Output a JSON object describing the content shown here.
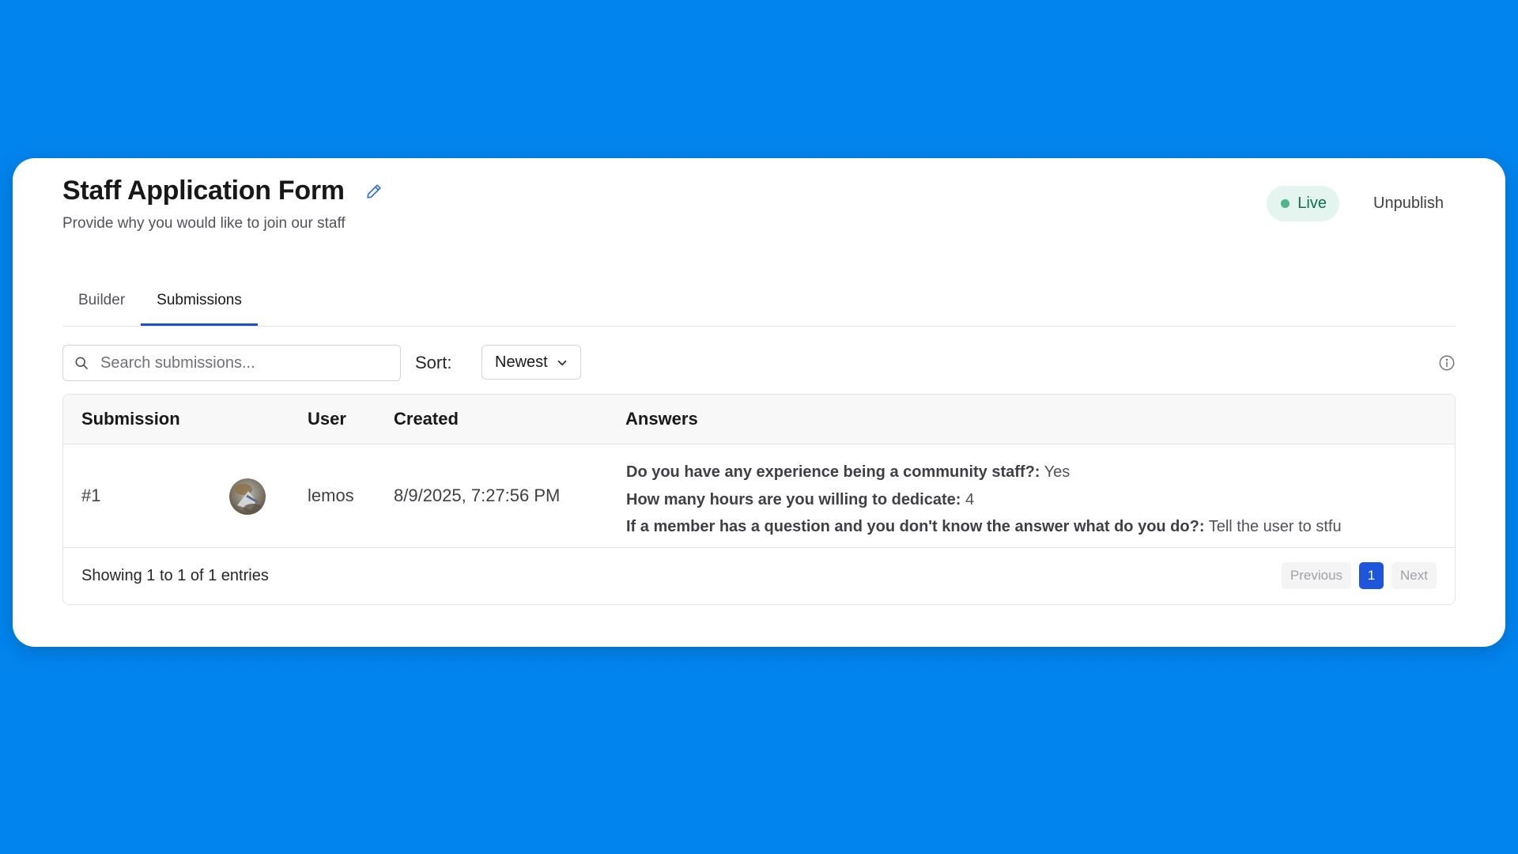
{
  "form": {
    "title": "Staff Application Form",
    "description": "Provide why you would like to join our staff"
  },
  "status": {
    "label": "Live",
    "color": "#4FB58A"
  },
  "actions": {
    "unpublish": "Unpublish"
  },
  "tabs": [
    {
      "label": "Builder",
      "active": false
    },
    {
      "label": "Submissions",
      "active": true
    }
  ],
  "toolbar": {
    "search_placeholder": "Search submissions...",
    "search_value": "",
    "sort_label": "Sort:",
    "sort_value": "Newest"
  },
  "table": {
    "columns": [
      "Submission",
      "User",
      "Created",
      "Answers"
    ],
    "rows": [
      {
        "id": "#1",
        "user": "lemos",
        "created": "8/9/2025, 7:27:56 PM",
        "answers": [
          {
            "q": "Do you have any experience being a community staff?:",
            "a": "Yes"
          },
          {
            "q": "How many hours are you willing to dedicate:",
            "a": "4"
          },
          {
            "q": "If a member has a question and you don't know the answer what do you do?:",
            "a": "Tell the user to stfu"
          }
        ]
      }
    ]
  },
  "footer": {
    "entries": "Showing 1 to 1 of 1 entries",
    "prev": "Previous",
    "page": "1",
    "next": "Next"
  },
  "colors": {
    "background": "#0284EE",
    "accent": "#1D56DB",
    "live_badge_bg": "#E3F5EE"
  }
}
